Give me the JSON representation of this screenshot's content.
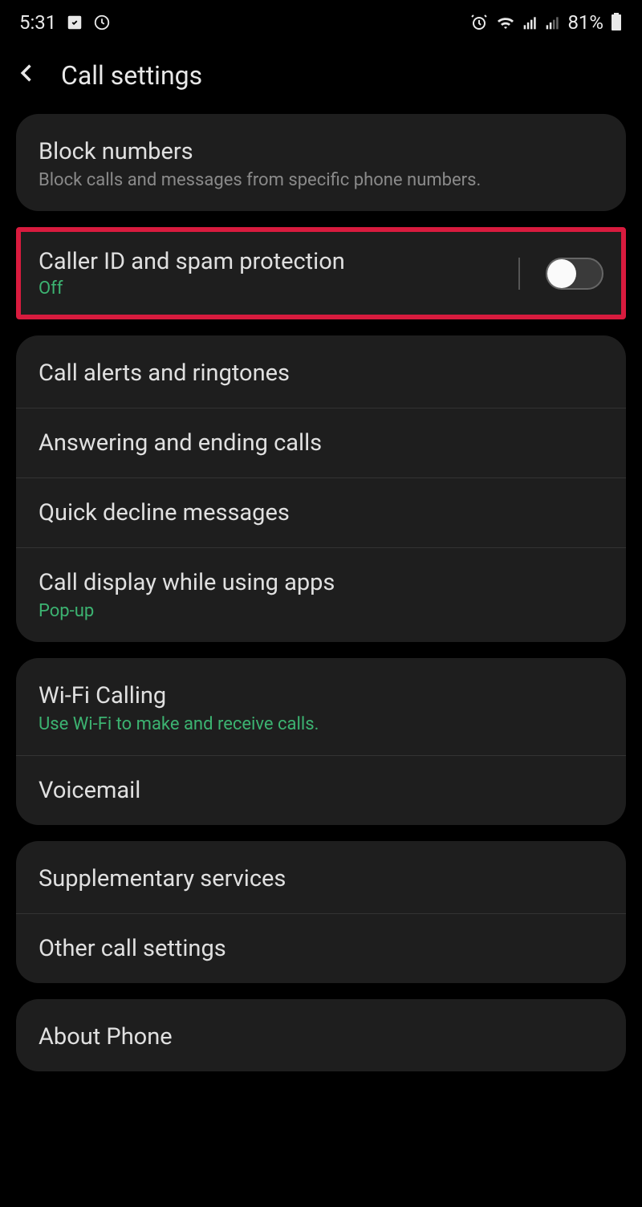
{
  "status": {
    "time": "5:31",
    "battery": "81%"
  },
  "header": {
    "title": "Call settings"
  },
  "group1": {
    "block_numbers": {
      "title": "Block numbers",
      "subtitle": "Block calls and messages from specific phone numbers."
    }
  },
  "highlighted": {
    "title": "Caller ID and spam protection",
    "status": "Off"
  },
  "group2": {
    "call_alerts": {
      "title": "Call alerts and ringtones"
    },
    "answering": {
      "title": "Answering and ending calls"
    },
    "quick_decline": {
      "title": "Quick decline messages"
    },
    "call_display": {
      "title": "Call display while using apps",
      "subtitle": "Pop-up"
    }
  },
  "group3": {
    "wifi_calling": {
      "title": "Wi-Fi Calling",
      "subtitle": "Use Wi-Fi to make and receive calls."
    },
    "voicemail": {
      "title": "Voicemail"
    }
  },
  "group4": {
    "supplementary": {
      "title": "Supplementary services"
    },
    "other": {
      "title": "Other call settings"
    }
  },
  "group5": {
    "about": {
      "title": "About Phone"
    }
  }
}
